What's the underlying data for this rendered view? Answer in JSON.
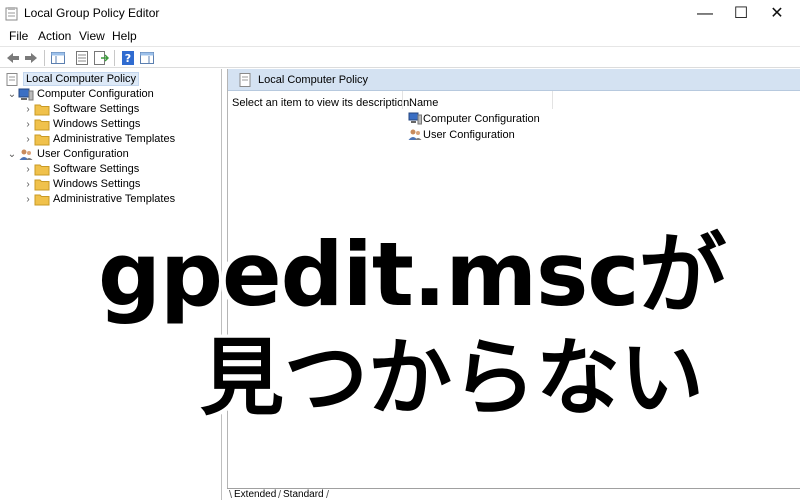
{
  "window": {
    "title": "Local Group Policy Editor",
    "controls": {
      "minimize": "—",
      "maximize": "☐",
      "close": "✕"
    }
  },
  "menu": [
    "File",
    "Action",
    "View",
    "Help"
  ],
  "toolbar": {
    "icons": [
      "back-arrow-icon",
      "forward-arrow-icon",
      "show-hide-tree-icon",
      "properties-icon",
      "export-list-icon",
      "help-icon",
      "show-pane-icon"
    ]
  },
  "tree": {
    "root": "Local Computer Policy",
    "computer": {
      "label": "Computer Configuration",
      "children": [
        "Software Settings",
        "Windows Settings",
        "Administrative Templates"
      ]
    },
    "user": {
      "label": "User Configuration",
      "children": [
        "Software Settings",
        "Windows Settings",
        "Administrative Templates"
      ]
    }
  },
  "detail": {
    "header": "Local Computer Policy",
    "description": "Select an item to view its description.",
    "column_name": "Name",
    "items": [
      "Computer Configuration",
      "User Configuration"
    ]
  },
  "tabs": [
    "Extended",
    "Standard"
  ],
  "overlay": {
    "line1": "gpedit.mscが",
    "line2": "見つからない"
  },
  "colors": {
    "header_bg": "#d4e2f2",
    "selection_bg": "#dde9f7",
    "folder": "#f0c14b"
  }
}
